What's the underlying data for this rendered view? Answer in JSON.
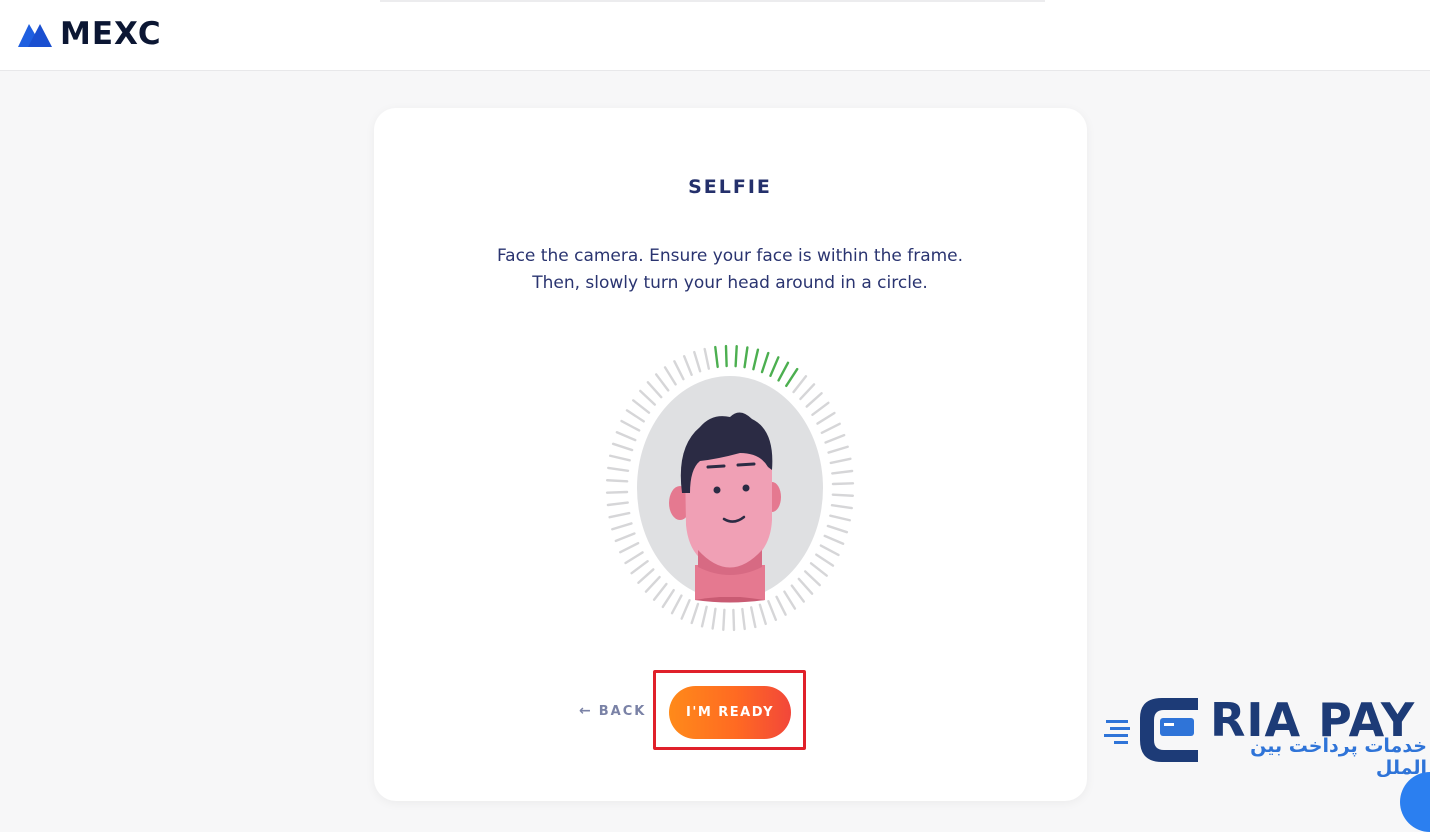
{
  "header": {
    "brand": "MEXC"
  },
  "selfie": {
    "title": "SELFIE",
    "instruction_line1": "Face the camera. Ensure your face is within the frame.",
    "instruction_line2": "Then, slowly turn your head around in a circle.",
    "progress_fraction": 0.12
  },
  "actions": {
    "back_arrow": "←",
    "back_label": "BACK",
    "ready_label": "I'M READY"
  },
  "watermark": {
    "logo_text": "RIA PAY",
    "tagline": "خدمات پرداخت بین الملل"
  },
  "colors": {
    "accent_orange": "#ff7a1a",
    "title_navy": "#24306b",
    "progress_green": "#4caf50",
    "tick_gray": "#d6d6d8",
    "highlight_red": "#e0202a",
    "watermark_blue": "#2f74d8"
  },
  "icons": {
    "brand_logo": "mexc-mountain-icon",
    "back": "arrow-left-icon",
    "chat": "chat-bubble-icon"
  }
}
